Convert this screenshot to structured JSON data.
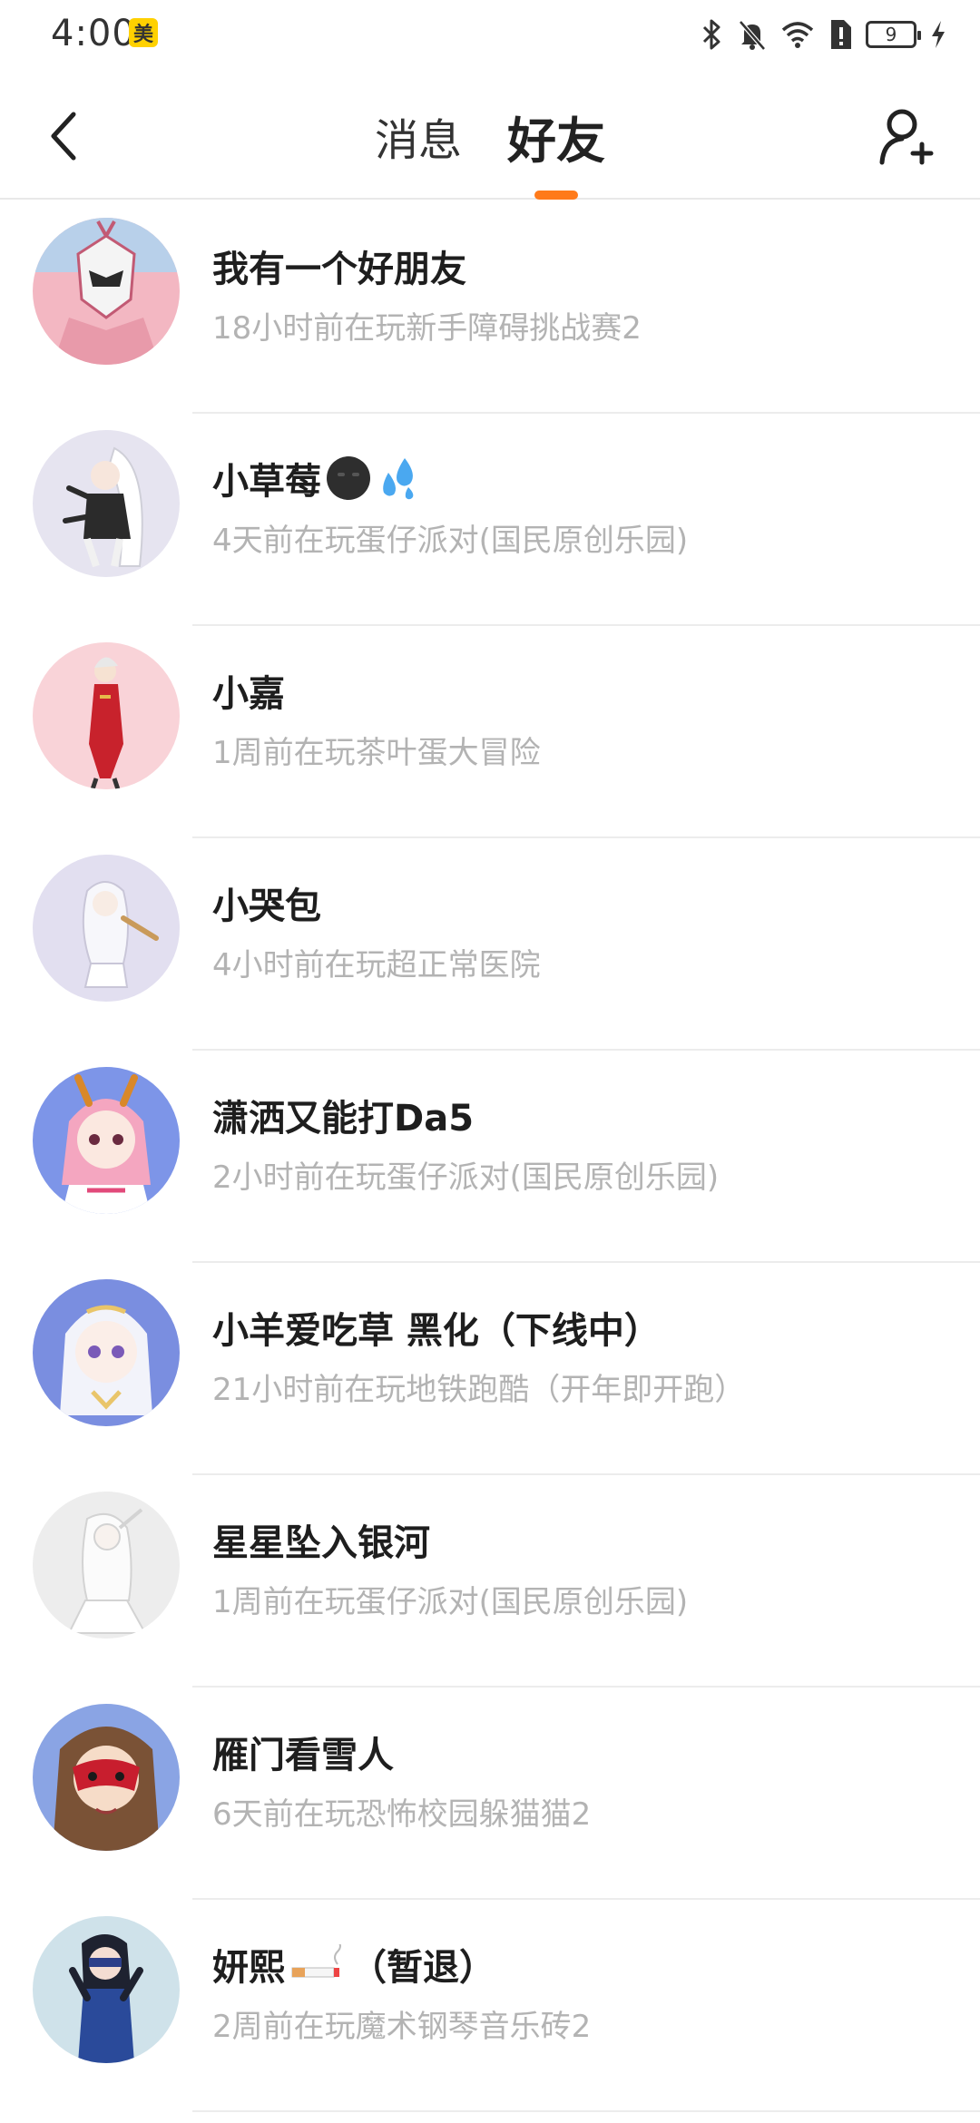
{
  "status_bar": {
    "time": "4:00",
    "app_badge": "美",
    "battery_level": "9"
  },
  "nav": {
    "tabs": [
      {
        "label": "消息",
        "active": false
      },
      {
        "label": "好友",
        "active": true
      }
    ],
    "accent_color": "#ff7a1a"
  },
  "friends": [
    {
      "name": "我有一个好朋友",
      "status": "18小时前在玩新手障碍挑战赛2",
      "avatar_bg": "#f3b7c2"
    },
    {
      "name": "小草莓",
      "status": "4天前在玩蛋仔派对(国民原创乐园)",
      "avatar_bg": "#e6e4f0"
    },
    {
      "name": "小嘉",
      "status": "1周前在玩茶叶蛋大冒险",
      "avatar_bg": "#f9d3d8"
    },
    {
      "name": "小哭包",
      "status": "4小时前在玩超正常医院",
      "avatar_bg": "#e2dff0"
    },
    {
      "name": "潇洒又能打Da5",
      "status": "2小时前在玩蛋仔派对(国民原创乐园)",
      "avatar_bg": "#7d95e8"
    },
    {
      "name": "小羊爱吃草  黑化（下线中）",
      "status": "21小时前在玩地铁跑酷（开年即开跑）",
      "avatar_bg": "#7a8ee0"
    },
    {
      "name": "星星坠入银河",
      "status": "1周前在玩蛋仔派对(国民原创乐园)",
      "avatar_bg": "#ededed"
    },
    {
      "name": "雁门看雪人",
      "status": "6天前在玩恐怖校园躲猫猫2",
      "avatar_bg": "#8aa4e4"
    },
    {
      "name": "妍熙",
      "name_suffix": "（暂退）",
      "status": "2周前在玩魔术钢琴音乐砖2",
      "avatar_bg": "#cfe2ea"
    }
  ]
}
